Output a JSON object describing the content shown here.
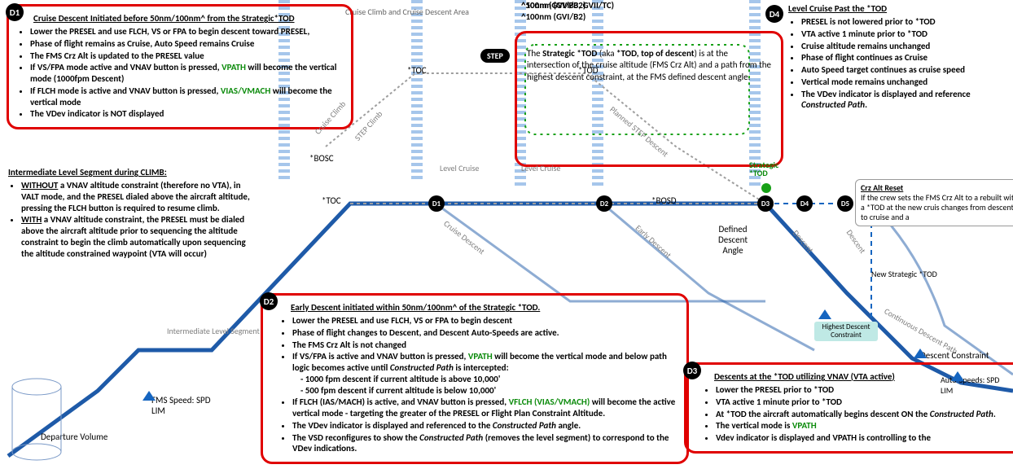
{
  "header": {
    "cruise_area": "Cruise Climb and Cruise Descent Area",
    "range_a": "^50nm (GVI/B3, GVII/TC)",
    "range_b": "^100nm (GVI/B2)"
  },
  "d1": {
    "badge": "D1",
    "title": "Cruise Descent Initiated before 50nm/100nm^  from the Strategic*TOD",
    "items": [
      "Lower the PRESEL and use FLCH, VS or FPA to begin descent toward PRESEL,",
      "Phase of flight remains as Cruise, Auto Speed remains Cruise",
      "The FMS Crz Alt is updated to the PRESEL value",
      "If VS/FPA mode active and VNAV button is pressed, <span class='green'>VPATH</span> will become the vertical mode (1000fpm Descent)",
      "If FLCH mode is active and VNAV button is pressed, <span class='green'>VIAS/VMACH</span> will become the vertical mode",
      "The VDev indicator is NOT displayed"
    ]
  },
  "tod_box": {
    "text": "The <b>Strategic *TOD</b> (aka <b>*TOD, top of descent</b>) is at the intersection of the cruise altitude (FMS Crz Alt) and a path from the highest descent constraint, at the FMS defined descent angle."
  },
  "d4": {
    "badge": "D4",
    "title": "Level Cruise Past the *TOD",
    "items": [
      "PRESEL is not lowered prior to *TOD",
      "VTA active 1 minute prior to *TOD",
      "Cruise altitude remains unchanged",
      "Phase of flight continues as Cruise",
      "Auto Speed target continues as cruise speed",
      "Vertical mode remains unchanged",
      "The VDev indicator is displayed and reference <span class='i'>Constructed Path</span>."
    ]
  },
  "crz_reset": {
    "title": "Crz Alt Reset",
    "text": "If the crew sets the FMS Crz Alt to a rebuilt with a *TOD at the new cruis changes from descent to cruise and a"
  },
  "int_level": {
    "title": "Intermediate Level Segment during CLIMB:",
    "items": [
      "<span class='u'>WITHOUT</span> a VNAV altitude constraint (therefore no VTA), in VALT mode, and the PRESEL dialed above the aircraft altitude, pressing the FLCH button is required to resume climb.",
      "<span class='u'>WITH</span> a VNAV altitude constraint, the PRESEL must be dialed above the aircraft altitude prior to sequencing the altitude constraint to begin the climb automatically upon sequencing the altitude constrained waypoint (VTA will occur)"
    ]
  },
  "d2": {
    "badge": "D2",
    "title": "Early Descent initiated within 50nm/100nm^ of the Strategic *TOD.",
    "items": [
      "Lower the PRESEL and use FLCH, VS or FPA to begin descent",
      "Phase of flight changes to Descent, and Descent Auto-Speeds are active.",
      "The FMS Crz Alt is not changed",
      "If VS/FPA is active and VNAV button is pressed, <span class='green'>VPATH</span> will become the vertical mode and below path logic becomes active until <span class='i'>Constructed Path</span> is intercepted:<br>&nbsp;&nbsp;&nbsp;&nbsp;- 1000 fpm descent if current altitude is above 10,000'<br>&nbsp;&nbsp;&nbsp;&nbsp;- 500 fpm descent if current altitude is below 10,000'",
      "If FLCH (IAS/MACH) is active, and VNAV button is pressed, <span class='green'>VFLCH (VIAS/VMACH)</span> will become the active vertical mode - targeting the greater of the PRESEL or Flight Plan Constraint Altitude.",
      "The VDev indicator is displayed and referenced to the <span class='i'>Constructed Path</span> angle.",
      "The VSD reconfigures to show the <span class='i'>Constructed Path</span> (removes the level segment) to correspond to the VDev indications."
    ]
  },
  "d3": {
    "badge": "D3",
    "title": "Descents at the *TOD utilizing VNAV (VTA active)",
    "items": [
      "Lower the PRESEL prior to *TOD",
      "VTA active 1 minute prior to *TOD",
      "At *TOD the aircraft automatically begins descent ON the <span class='i'>Constructed Path</span>.",
      "The vertical mode is <span class='green'>VPATH</span>",
      "Vdev indicator is displayed and VPATH is controlling to the"
    ]
  },
  "labels": {
    "toc1": "*TOC",
    "toc2": "*TOC",
    "tod": "*TOD",
    "bosd": "*BOSD",
    "bosc": "*BOSC",
    "step": "STEP",
    "cruise_climb": "Cruise Climb",
    "step_climb": "STEP Climb",
    "planned_step": "Planned STEP Descent",
    "level_cruise": "Level Cruise",
    "cruise_descent": "Cruise Descent",
    "early_descent": "Early Descent",
    "descent": "Descent",
    "defined_angle": "Defined Descent Angle",
    "strategic_tod": "Strategic *TOD",
    "new_strategic": "New Strategic *TOD",
    "hdc": "Highest Descent Constraint",
    "cdc": "Continuous Descent Path",
    "dc": "Descent Constraint",
    "auto_speeds": "Auto-Speeds: SPD LIM",
    "fms_speed": "FMS Speed: SPD LIM",
    "dep_vol": "Departure Volume",
    "int_seg": "Intermediate Level Segment"
  },
  "markers": {
    "d1": "D1",
    "d2": "D2",
    "d3": "D3",
    "d4": "D4",
    "d5": "D5"
  }
}
